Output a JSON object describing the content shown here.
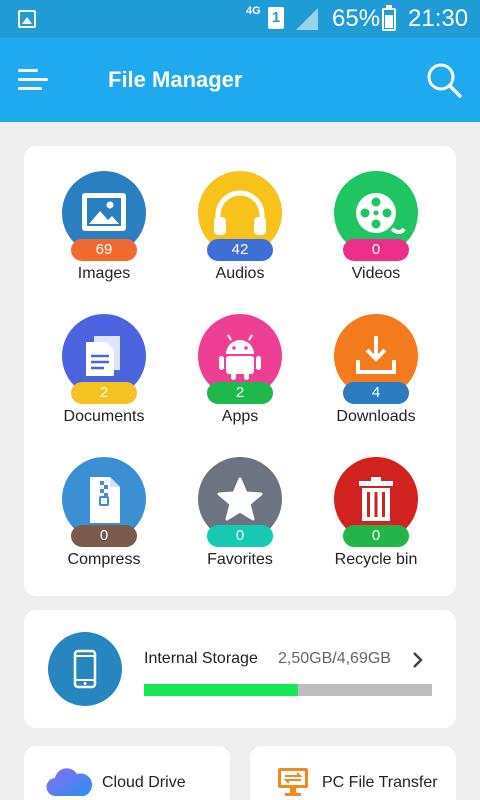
{
  "status_bar": {
    "network": "4G",
    "sim": "1",
    "battery_percent": "65%",
    "time": "21:30"
  },
  "app_bar": {
    "title": "File Manager",
    "menu_icon": "hamburger-menu-icon",
    "search_icon": "search-icon"
  },
  "categories": [
    {
      "label": "Images",
      "count": "69",
      "icon": "image-icon",
      "circle_color": "#2a7fc0",
      "badge_color": "#f26a2e"
    },
    {
      "label": "Audios",
      "count": "42",
      "icon": "headphones-icon",
      "circle_color": "#f6c21b",
      "badge_color": "#3d6fd6"
    },
    {
      "label": "Videos",
      "count": "0",
      "icon": "film-reel-icon",
      "circle_color": "#1fc463",
      "badge_color": "#ee2f8a"
    },
    {
      "label": "Documents",
      "count": "2",
      "icon": "document-icon",
      "circle_color": "#4c63df",
      "badge_color": "#f4c321"
    },
    {
      "label": "Apps",
      "count": "2",
      "icon": "android-icon",
      "circle_color": "#ee3f95",
      "badge_color": "#1fb84a"
    },
    {
      "label": "Downloads",
      "count": "4",
      "icon": "download-icon",
      "circle_color": "#f47a1e",
      "badge_color": "#2b7bc0"
    },
    {
      "label": "Compress",
      "count": "0",
      "icon": "zip-file-icon",
      "circle_color": "#3d8fd4",
      "badge_color": "#7a5a4a"
    },
    {
      "label": "Favorites",
      "count": "0",
      "icon": "star-icon",
      "circle_color": "#6b7480",
      "badge_color": "#16c9b3"
    },
    {
      "label": "Recycle bin",
      "count": "0",
      "icon": "trash-icon",
      "circle_color": "#d1221f",
      "badge_color": "#22b54a"
    }
  ],
  "storage": {
    "label": "Internal Storage",
    "size": "2,50GB/4,69GB",
    "used_fraction": 0.533,
    "icon": "phone-icon",
    "bar_color": "#17e85a"
  },
  "bottom": {
    "cloud_label": "Cloud Drive",
    "cloud_icon": "cloud-icon",
    "pc_label": "PC File Transfer",
    "pc_icon": "pc-transfer-icon"
  }
}
